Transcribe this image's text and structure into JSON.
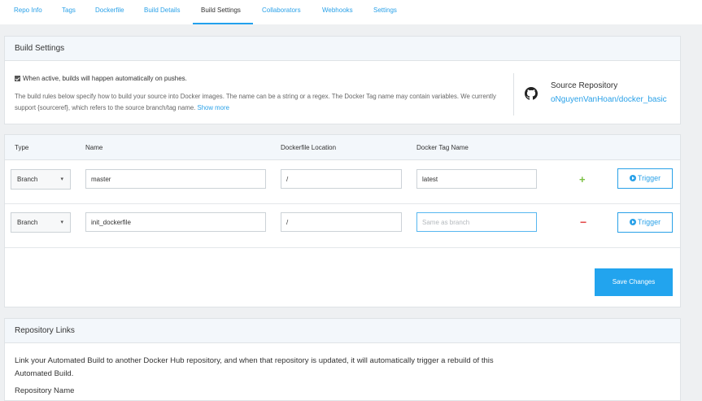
{
  "nav": {
    "tabs": [
      {
        "label": "Repo Info",
        "active": false
      },
      {
        "label": "Tags",
        "active": false
      },
      {
        "label": "Dockerfile",
        "active": false
      },
      {
        "label": "Build Details",
        "active": false
      },
      {
        "label": "Build Settings",
        "active": true
      },
      {
        "label": "Collaborators",
        "active": false
      },
      {
        "label": "Webhooks",
        "active": false
      },
      {
        "label": "Settings",
        "active": false
      }
    ]
  },
  "build_settings": {
    "title": "Build Settings",
    "auto_build_label": "When active, builds will happen automatically on pushes.",
    "auto_build_checked": true,
    "description": "The build rules below specify how to build your source into Docker images. The name can be a string or a regex. The Docker Tag name may contain variables. We currently support {sourceref}, which refers to the source branch/tag name.",
    "show_more": "Show more",
    "source_repo_title": "Source Repository",
    "source_repo_link": "oNguyenVanHoan/docker_basic",
    "source_icon": "github-icon"
  },
  "rules": {
    "headers": {
      "type": "Type",
      "name": "Name",
      "location": "Dockerfile Location",
      "tag": "Docker Tag Name"
    },
    "rows": [
      {
        "type": "Branch",
        "name": "master",
        "location": "/",
        "tag": "latest",
        "tag_placeholder": "",
        "action": "+",
        "action_icon": "plus-icon",
        "trigger": "Trigger"
      },
      {
        "type": "Branch",
        "name": "init_dockerfile",
        "location": "/",
        "tag": "",
        "tag_placeholder": "Same as branch",
        "action": "−",
        "action_icon": "minus-icon",
        "trigger": "Trigger"
      }
    ],
    "save_label": "Save Changes"
  },
  "repo_links": {
    "title": "Repository Links",
    "body": "Link your Automated Build to another Docker Hub repository, and when that repository is updated, it will automatically trigger a rebuild of this Automated Build.",
    "repo_name_label": "Repository Name"
  },
  "colors": {
    "accent": "#22a1ed",
    "add": "#7bc043",
    "remove": "#e24848"
  }
}
